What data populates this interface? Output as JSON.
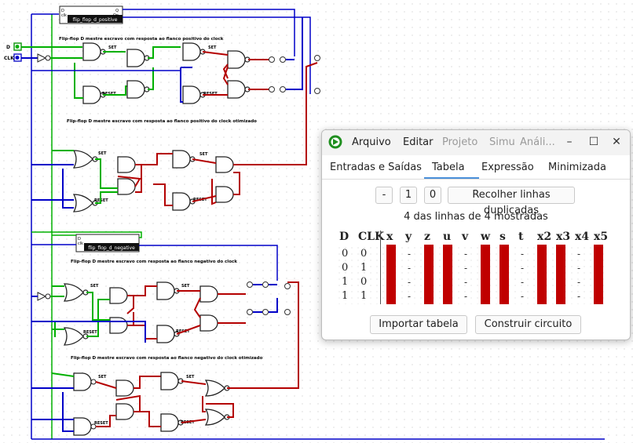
{
  "canvas": {
    "subcircuit_labels": [
      "flip_flop_d_positive",
      "flip_flop_d_negative"
    ],
    "section_captions": [
      "Flip-flop D mestre escravo com resposta ao flanco positivo do clock",
      "Flip-flop D mestre escravo com resposta ao flanco positivo do clock otimizado",
      "Flip-flop D mestre escravo com resposta ao flanco negativo do clock",
      "Flip-flop D mestre escravo com resposta ao flanco negativo do clock otimizado"
    ],
    "input_labels": {
      "d": "D",
      "clk": "CLK"
    },
    "gate_labels": {
      "set": "SET",
      "reset": "RESET"
    },
    "pin_labels": {
      "d": "D",
      "q": "Q",
      "clk": "clk",
      "qn": "Qn"
    },
    "wire_colors": {
      "high": "#00b000",
      "low": "#0000c8",
      "error": "#b40000",
      "black": "#222222"
    }
  },
  "window": {
    "menu": [
      "Arquivo",
      "Editar",
      "Projeto",
      "Simu",
      "Análi..."
    ],
    "disabled_menu": [
      "Projeto",
      "Simu",
      "Análi..."
    ],
    "controls": {
      "minimize": "–",
      "maximize": "☐",
      "close": "✕"
    },
    "tabs": [
      "Entradas e Saídas",
      "Tabela",
      "Expressão",
      "Minimizada"
    ],
    "active_tab": "Tabela",
    "toolbar": {
      "minus": "-",
      "one": "1",
      "zero": "0",
      "collapse": "Recolher linhas duplicadas"
    },
    "rows_shown": "4 das linhas de 4 mostradas",
    "inputs": [
      "D",
      "CLK"
    ],
    "outputs": [
      "x",
      "y",
      "z",
      "u",
      "v",
      "w",
      "s",
      "t",
      "x2",
      "x3",
      "x4",
      "x5"
    ],
    "rows": [
      [
        "0",
        "0"
      ],
      [
        "0",
        "1"
      ],
      [
        "1",
        "0"
      ],
      [
        "1",
        "1"
      ]
    ],
    "output_cells": {
      "x": "error",
      "y": "-",
      "z": "error",
      "u": "error",
      "v": "-",
      "w": "error",
      "s": "error",
      "t": "-",
      "x2": "error",
      "x3": "error",
      "x4": "-",
      "x5": "error"
    },
    "error_color": "#c00000",
    "buttons": {
      "import": "Importar tabela",
      "build": "Construir circuito"
    }
  }
}
